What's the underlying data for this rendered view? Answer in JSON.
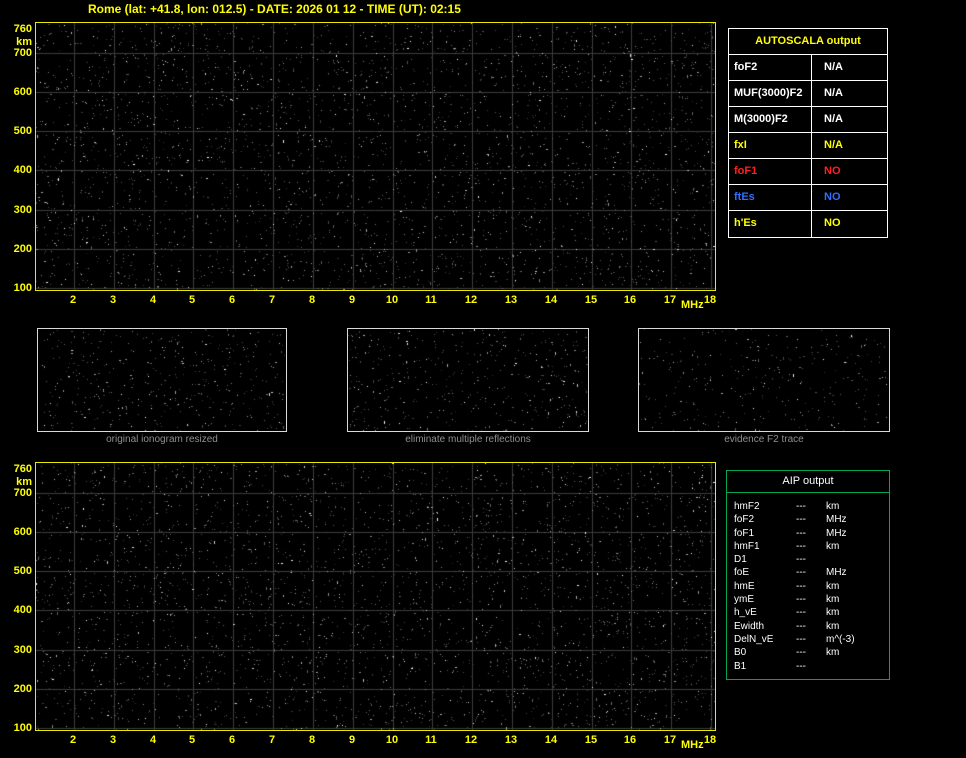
{
  "header": {
    "title": "Rome (lat: +41.8, lon: 012.5) - DATE: 2026 01 12 - TIME (UT): 02:15"
  },
  "colors": {
    "axis_yellow": "#ffff00",
    "frame_yellow": "#e8e800",
    "grid_gray": "#3c3c3c",
    "table_border_white": "#ffffff",
    "value_red": "#ff2020",
    "value_blue": "#2f6fff",
    "aip_green": "#00a651",
    "caption_gray": "#8f8f8f",
    "background": "#000000"
  },
  "ionogram": {
    "y_unit": "km",
    "x_unit": "MHz",
    "y_ticks": [
      760,
      700,
      600,
      500,
      400,
      300,
      200,
      100
    ],
    "x_ticks": [
      2,
      3,
      4,
      5,
      6,
      7,
      8,
      9,
      10,
      11,
      12,
      13,
      14,
      15,
      16,
      17,
      18
    ]
  },
  "chart_data": [
    {
      "type": "scatter",
      "title": "main ionogram (top)",
      "xlabel": "MHz",
      "ylabel": "km",
      "xlim": [
        2,
        18
      ],
      "ylim": [
        100,
        760
      ],
      "x_ticks": [
        2,
        3,
        4,
        5,
        6,
        7,
        8,
        9,
        10,
        11,
        12,
        13,
        14,
        15,
        16,
        17,
        18
      ],
      "y_ticks": [
        100,
        200,
        300,
        400,
        500,
        600,
        700,
        760
      ],
      "grid": true,
      "series": [],
      "annotation": "no ionospheric echo trace visible; uniform background noise speckle only"
    },
    {
      "type": "scatter",
      "title": "processed ionogram (bottom)",
      "xlabel": "MHz",
      "ylabel": "km",
      "xlim": [
        2,
        18
      ],
      "ylim": [
        100,
        760
      ],
      "x_ticks": [
        2,
        3,
        4,
        5,
        6,
        7,
        8,
        9,
        10,
        11,
        12,
        13,
        14,
        15,
        16,
        17,
        18
      ],
      "y_ticks": [
        100,
        200,
        300,
        400,
        500,
        600,
        700,
        760
      ],
      "grid": true,
      "series": [],
      "annotation": "no ionospheric echo trace visible; uniform background noise speckle only"
    }
  ],
  "autoscala": {
    "header": "AUTOSCALA output",
    "rows": [
      {
        "label": "foF2",
        "value": "N/A",
        "color": "#ffffff"
      },
      {
        "label": "MUF(3000)F2",
        "value": "N/A",
        "color": "#ffffff"
      },
      {
        "label": "M(3000)F2",
        "value": "N/A",
        "color": "#ffffff"
      },
      {
        "label": "fxI",
        "value": "N/A",
        "color": "#ffff00"
      },
      {
        "label": "foF1",
        "value": "NO",
        "color": "#ff2020"
      },
      {
        "label": "ftEs",
        "value": "NO",
        "color": "#2f6fff"
      },
      {
        "label": "h'Es",
        "value": "NO",
        "color": "#ffff00"
      }
    ]
  },
  "panels": [
    {
      "caption": "original ionogram resized"
    },
    {
      "caption": "eliminate multiple reflections"
    },
    {
      "caption": "evidence F2 trace"
    }
  ],
  "aip": {
    "header": "AIP output",
    "rows": [
      {
        "param": "hmF2",
        "value": "---",
        "unit": "km"
      },
      {
        "param": "foF2",
        "value": "---",
        "unit": "MHz"
      },
      {
        "param": "foF1",
        "value": "---",
        "unit": "MHz"
      },
      {
        "param": "hmF1",
        "value": "---",
        "unit": "km"
      },
      {
        "param": "D1",
        "value": "---",
        "unit": ""
      },
      {
        "param": "foE",
        "value": "---",
        "unit": "MHz"
      },
      {
        "param": "hmE",
        "value": "---",
        "unit": "km"
      },
      {
        "param": "ymE",
        "value": "---",
        "unit": "km"
      },
      {
        "param": "h_vE",
        "value": "---",
        "unit": "km"
      },
      {
        "param": "Ewidth",
        "value": "---",
        "unit": "km"
      },
      {
        "param": "DelN_vE",
        "value": "---",
        "unit": "m^(-3)"
      },
      {
        "param": "B0",
        "value": "---",
        "unit": "km"
      },
      {
        "param": "B1",
        "value": "---",
        "unit": ""
      }
    ]
  }
}
